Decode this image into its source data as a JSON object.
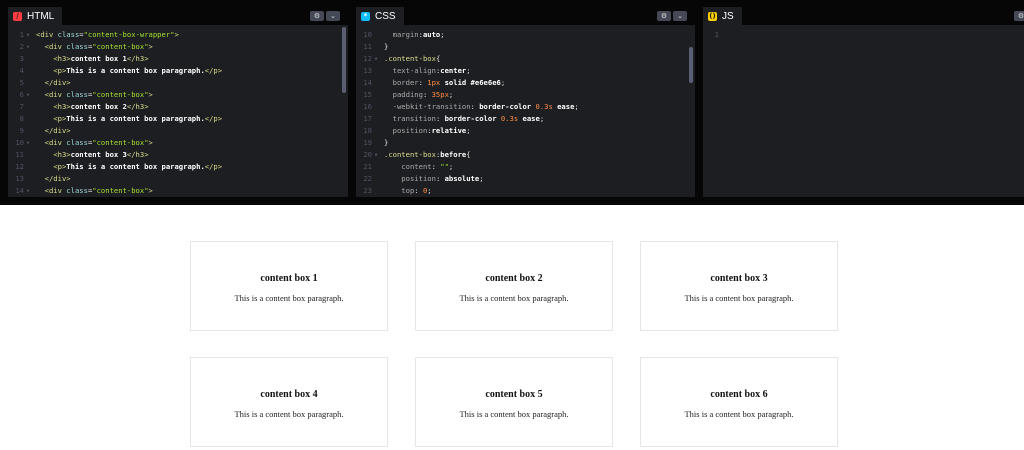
{
  "panes": {
    "html": {
      "tab": "HTML",
      "icon": "/"
    },
    "css": {
      "tab": "CSS",
      "icon": "*"
    },
    "js": {
      "tab": "JS",
      "icon": "()"
    }
  },
  "html_code": [
    {
      "n": "1",
      "fold": true,
      "segs": [
        [
          "t-tag",
          "<div "
        ],
        [
          "t-attr",
          "class"
        ],
        [
          "t-punc",
          "="
        ],
        [
          "t-val",
          "\"content-box-wrapper\""
        ],
        [
          "t-tag",
          ">"
        ]
      ]
    },
    {
      "n": "2",
      "fold": true,
      "segs": [
        [
          "t-punc",
          "  "
        ],
        [
          "t-tag",
          "<div "
        ],
        [
          "t-attr",
          "class"
        ],
        [
          "t-punc",
          "="
        ],
        [
          "t-val",
          "\"content-box\""
        ],
        [
          "t-tag",
          ">"
        ]
      ]
    },
    {
      "n": "3",
      "fold": false,
      "segs": [
        [
          "t-punc",
          "    "
        ],
        [
          "t-tag",
          "<h3>"
        ],
        [
          "t-text",
          "content box 1"
        ],
        [
          "t-tag",
          "</h3>"
        ]
      ]
    },
    {
      "n": "4",
      "fold": false,
      "segs": [
        [
          "t-punc",
          "    "
        ],
        [
          "t-tag",
          "<p>"
        ],
        [
          "t-text",
          "This is a content box paragraph."
        ],
        [
          "t-tag",
          "</p>"
        ]
      ]
    },
    {
      "n": "5",
      "fold": false,
      "segs": [
        [
          "t-punc",
          "  "
        ],
        [
          "t-tag",
          "</div>"
        ]
      ]
    },
    {
      "n": "6",
      "fold": true,
      "segs": [
        [
          "t-punc",
          "  "
        ],
        [
          "t-tag",
          "<div "
        ],
        [
          "t-attr",
          "class"
        ],
        [
          "t-punc",
          "="
        ],
        [
          "t-val",
          "\"content-box\""
        ],
        [
          "t-tag",
          ">"
        ]
      ]
    },
    {
      "n": "7",
      "fold": false,
      "segs": [
        [
          "t-punc",
          "    "
        ],
        [
          "t-tag",
          "<h3>"
        ],
        [
          "t-text",
          "content box 2"
        ],
        [
          "t-tag",
          "</h3>"
        ]
      ]
    },
    {
      "n": "8",
      "fold": false,
      "segs": [
        [
          "t-punc",
          "    "
        ],
        [
          "t-tag",
          "<p>"
        ],
        [
          "t-text",
          "This is a content box paragraph."
        ],
        [
          "t-tag",
          "</p>"
        ]
      ]
    },
    {
      "n": "9",
      "fold": false,
      "segs": [
        [
          "t-punc",
          "  "
        ],
        [
          "t-tag",
          "</div>"
        ]
      ]
    },
    {
      "n": "10",
      "fold": true,
      "segs": [
        [
          "t-punc",
          "  "
        ],
        [
          "t-tag",
          "<div "
        ],
        [
          "t-attr",
          "class"
        ],
        [
          "t-punc",
          "="
        ],
        [
          "t-val",
          "\"content-box\""
        ],
        [
          "t-tag",
          ">"
        ]
      ]
    },
    {
      "n": "11",
      "fold": false,
      "segs": [
        [
          "t-punc",
          "    "
        ],
        [
          "t-tag",
          "<h3>"
        ],
        [
          "t-text",
          "content box 3"
        ],
        [
          "t-tag",
          "</h3>"
        ]
      ]
    },
    {
      "n": "12",
      "fold": false,
      "segs": [
        [
          "t-punc",
          "    "
        ],
        [
          "t-tag",
          "<p>"
        ],
        [
          "t-text",
          "This is a content box paragraph."
        ],
        [
          "t-tag",
          "</p>"
        ]
      ]
    },
    {
      "n": "13",
      "fold": false,
      "segs": [
        [
          "t-punc",
          "  "
        ],
        [
          "t-tag",
          "</div>"
        ]
      ]
    },
    {
      "n": "14",
      "fold": true,
      "segs": [
        [
          "t-punc",
          "  "
        ],
        [
          "t-tag",
          "<div "
        ],
        [
          "t-attr",
          "class"
        ],
        [
          "t-punc",
          "="
        ],
        [
          "t-val",
          "\"content-box\""
        ],
        [
          "t-tag",
          ">"
        ]
      ]
    }
  ],
  "css_code": [
    {
      "n": "10",
      "fold": false,
      "segs": [
        [
          "t-prop",
          "  margin"
        ],
        [
          "t-punc",
          ":"
        ],
        [
          "t-pval",
          "auto"
        ],
        [
          "t-punc",
          ";"
        ]
      ]
    },
    {
      "n": "11",
      "fold": false,
      "segs": [
        [
          "t-punc",
          "}"
        ]
      ]
    },
    {
      "n": "12",
      "fold": true,
      "segs": [
        [
          "t-sel",
          ".content-box"
        ],
        [
          "t-punc",
          "{"
        ]
      ]
    },
    {
      "n": "13",
      "fold": false,
      "segs": [
        [
          "t-prop",
          "  text-align"
        ],
        [
          "t-punc",
          ":"
        ],
        [
          "t-pval",
          "center"
        ],
        [
          "t-punc",
          ";"
        ]
      ]
    },
    {
      "n": "14",
      "fold": false,
      "segs": [
        [
          "t-prop",
          "  border"
        ],
        [
          "t-punc",
          ": "
        ],
        [
          "t-num",
          "1px"
        ],
        [
          "t-pval",
          " solid #e6e6e6"
        ],
        [
          "t-punc",
          ";"
        ]
      ]
    },
    {
      "n": "15",
      "fold": false,
      "segs": [
        [
          "t-prop",
          "  padding"
        ],
        [
          "t-punc",
          ": "
        ],
        [
          "t-num",
          "35px"
        ],
        [
          "t-punc",
          ";"
        ]
      ]
    },
    {
      "n": "16",
      "fold": false,
      "segs": [
        [
          "t-prop",
          "  -webkit-transition"
        ],
        [
          "t-punc",
          ": "
        ],
        [
          "t-pval",
          "border-color "
        ],
        [
          "t-num",
          "0.3s"
        ],
        [
          "t-pval",
          " ease"
        ],
        [
          "t-punc",
          ";"
        ]
      ]
    },
    {
      "n": "17",
      "fold": false,
      "segs": [
        [
          "t-prop",
          "  transition"
        ],
        [
          "t-punc",
          ": "
        ],
        [
          "t-pval",
          "border-color "
        ],
        [
          "t-num",
          "0.3s"
        ],
        [
          "t-pval",
          " ease"
        ],
        [
          "t-punc",
          ";"
        ]
      ]
    },
    {
      "n": "18",
      "fold": false,
      "segs": [
        [
          "t-prop",
          "  position"
        ],
        [
          "t-punc",
          ":"
        ],
        [
          "t-pval",
          "relative"
        ],
        [
          "t-punc",
          ";"
        ]
      ]
    },
    {
      "n": "19",
      "fold": false,
      "segs": [
        [
          "t-punc",
          "}"
        ]
      ]
    },
    {
      "n": "20",
      "fold": true,
      "segs": [
        [
          "t-sel",
          ".content-box"
        ],
        [
          "t-punc",
          ":"
        ],
        [
          "t-pval",
          "before"
        ],
        [
          "t-punc",
          "{"
        ]
      ]
    },
    {
      "n": "21",
      "fold": false,
      "segs": [
        [
          "t-prop",
          "    content"
        ],
        [
          "t-punc",
          ": "
        ],
        [
          "t-val",
          "\"\""
        ],
        [
          "t-punc",
          ";"
        ]
      ]
    },
    {
      "n": "22",
      "fold": false,
      "segs": [
        [
          "t-prop",
          "    position"
        ],
        [
          "t-punc",
          ": "
        ],
        [
          "t-pval",
          "absolute"
        ],
        [
          "t-punc",
          ";"
        ]
      ]
    },
    {
      "n": "23",
      "fold": false,
      "segs": [
        [
          "t-prop",
          "    top"
        ],
        [
          "t-punc",
          ": "
        ],
        [
          "t-num",
          "0"
        ],
        [
          "t-punc",
          ";"
        ]
      ]
    }
  ],
  "js_code": [
    {
      "n": "1",
      "fold": false,
      "segs": []
    }
  ],
  "preview": {
    "boxes": [
      {
        "title": "content box 1",
        "text": "This is a content box paragraph."
      },
      {
        "title": "content box 2",
        "text": "This is a content box paragraph."
      },
      {
        "title": "content box 3",
        "text": "This is a content box paragraph."
      },
      {
        "title": "content box 4",
        "text": "This is a content box paragraph."
      },
      {
        "title": "content box 5",
        "text": "This is a content box paragraph."
      },
      {
        "title": "content box 6",
        "text": "This is a content box paragraph."
      }
    ]
  },
  "colors": {
    "editor_bg": "#1d1e22",
    "chrome_bg": "#060606",
    "html_accent": "#ff3c41",
    "css_accent": "#0ebeff",
    "js_accent": "#fcd000",
    "box_border": "#e6e6e6"
  },
  "icons": {
    "settings": "gear-icon",
    "collapse": "chevron-down-icon"
  }
}
